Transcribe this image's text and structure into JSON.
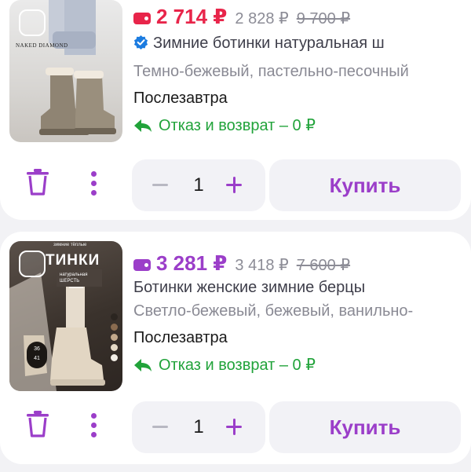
{
  "colors": {
    "accent": "#9b3ec9",
    "sale_red": "#e8254a",
    "sale_purple": "#9b3ec9",
    "return_green": "#21a33a",
    "verified_blue": "#1c7ce0"
  },
  "items": [
    {
      "image": {
        "brand_text": "NAKED DIAMOND"
      },
      "price": {
        "current": "2 714 ₽",
        "wallet_price": "2 828 ₽",
        "original": "9 700 ₽",
        "current_color": "#e8254a"
      },
      "title": "Зимние ботинки натуральная ш",
      "verified": true,
      "color_text": "Темно-бежевый, пастельно-песочный",
      "delivery": "Послезавтра",
      "return_text": "Отказ и возврат – 0 ₽",
      "quantity": "1",
      "buy_label": "Купить"
    },
    {
      "image": {
        "promo_top": "зимние         тёплые",
        "promo_title": "ТИНКИ",
        "promo_box": "натуральная ШЕРСТЬ",
        "size_from": "36",
        "size_to": "41"
      },
      "price": {
        "current": "3 281 ₽",
        "wallet_price": "3 418 ₽",
        "original": "7 600 ₽",
        "current_color": "#9b3ec9"
      },
      "title": "Ботинки женские зимние берцы",
      "verified": false,
      "color_text": "Светло-бежевый, бежевый, ванильно-",
      "delivery": "Послезавтра",
      "return_text": "Отказ и возврат – 0 ₽",
      "quantity": "1",
      "buy_label": "Купить"
    }
  ]
}
